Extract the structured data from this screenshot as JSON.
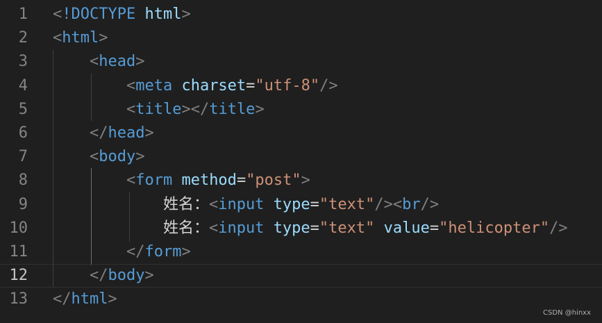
{
  "editor": {
    "lines": [
      {
        "number": "1",
        "tokens": [
          [
            "p",
            "<"
          ],
          [
            "d",
            "!DOCTYPE"
          ],
          [
            "x",
            " "
          ],
          [
            "a",
            "html"
          ],
          [
            "p",
            ">"
          ]
        ]
      },
      {
        "number": "2",
        "tokens": [
          [
            "p",
            "<"
          ],
          [
            "t",
            "html"
          ],
          [
            "p",
            ">"
          ]
        ]
      },
      {
        "number": "3",
        "tokens": [
          [
            "x",
            "    "
          ],
          [
            "p",
            "<"
          ],
          [
            "t",
            "head"
          ],
          [
            "p",
            ">"
          ]
        ]
      },
      {
        "number": "4",
        "tokens": [
          [
            "x",
            "        "
          ],
          [
            "p",
            "<"
          ],
          [
            "t",
            "meta"
          ],
          [
            "x",
            " "
          ],
          [
            "a",
            "charset"
          ],
          [
            "x",
            "="
          ],
          [
            "s",
            "\"utf-8\""
          ],
          [
            "p",
            "/>"
          ]
        ]
      },
      {
        "number": "5",
        "tokens": [
          [
            "x",
            "        "
          ],
          [
            "p",
            "<"
          ],
          [
            "t",
            "title"
          ],
          [
            "p",
            "></"
          ],
          [
            "t",
            "title"
          ],
          [
            "p",
            ">"
          ]
        ]
      },
      {
        "number": "6",
        "tokens": [
          [
            "x",
            "    "
          ],
          [
            "p",
            "</"
          ],
          [
            "t",
            "head"
          ],
          [
            "p",
            ">"
          ]
        ]
      },
      {
        "number": "7",
        "tokens": [
          [
            "x",
            "    "
          ],
          [
            "p",
            "<"
          ],
          [
            "t",
            "body"
          ],
          [
            "p",
            ">"
          ]
        ]
      },
      {
        "number": "8",
        "tokens": [
          [
            "x",
            "        "
          ],
          [
            "p",
            "<"
          ],
          [
            "t",
            "form"
          ],
          [
            "x",
            " "
          ],
          [
            "a",
            "method"
          ],
          [
            "x",
            "="
          ],
          [
            "s",
            "\"post\""
          ],
          [
            "p",
            ">"
          ]
        ]
      },
      {
        "number": "9",
        "tokens": [
          [
            "x",
            "            姓名："
          ],
          [
            "p",
            "<"
          ],
          [
            "t",
            "input"
          ],
          [
            "x",
            " "
          ],
          [
            "a",
            "type"
          ],
          [
            "x",
            "="
          ],
          [
            "s",
            "\"text\""
          ],
          [
            "p",
            "/><"
          ],
          [
            "t",
            "br"
          ],
          [
            "p",
            "/>"
          ]
        ]
      },
      {
        "number": "10",
        "tokens": [
          [
            "x",
            "            姓名："
          ],
          [
            "p",
            "<"
          ],
          [
            "t",
            "input"
          ],
          [
            "x",
            " "
          ],
          [
            "a",
            "type"
          ],
          [
            "x",
            "="
          ],
          [
            "s",
            "\"text\""
          ],
          [
            "x",
            " "
          ],
          [
            "a",
            "value"
          ],
          [
            "x",
            "="
          ],
          [
            "s",
            "\"helicopter\""
          ],
          [
            "p",
            "/>"
          ]
        ]
      },
      {
        "number": "11",
        "tokens": [
          [
            "x",
            "        "
          ],
          [
            "p",
            "</"
          ],
          [
            "t",
            "form"
          ],
          [
            "p",
            ">"
          ]
        ]
      },
      {
        "number": "12",
        "tokens": [
          [
            "x",
            "    "
          ],
          [
            "p",
            "</"
          ],
          [
            "t",
            "body"
          ],
          [
            "p",
            ">"
          ]
        ]
      },
      {
        "number": "13",
        "tokens": [
          [
            "p",
            "</"
          ],
          [
            "t",
            "html"
          ],
          [
            "p",
            ">"
          ]
        ]
      }
    ],
    "current_line": "12"
  },
  "watermark": "CSDN @hinxx"
}
